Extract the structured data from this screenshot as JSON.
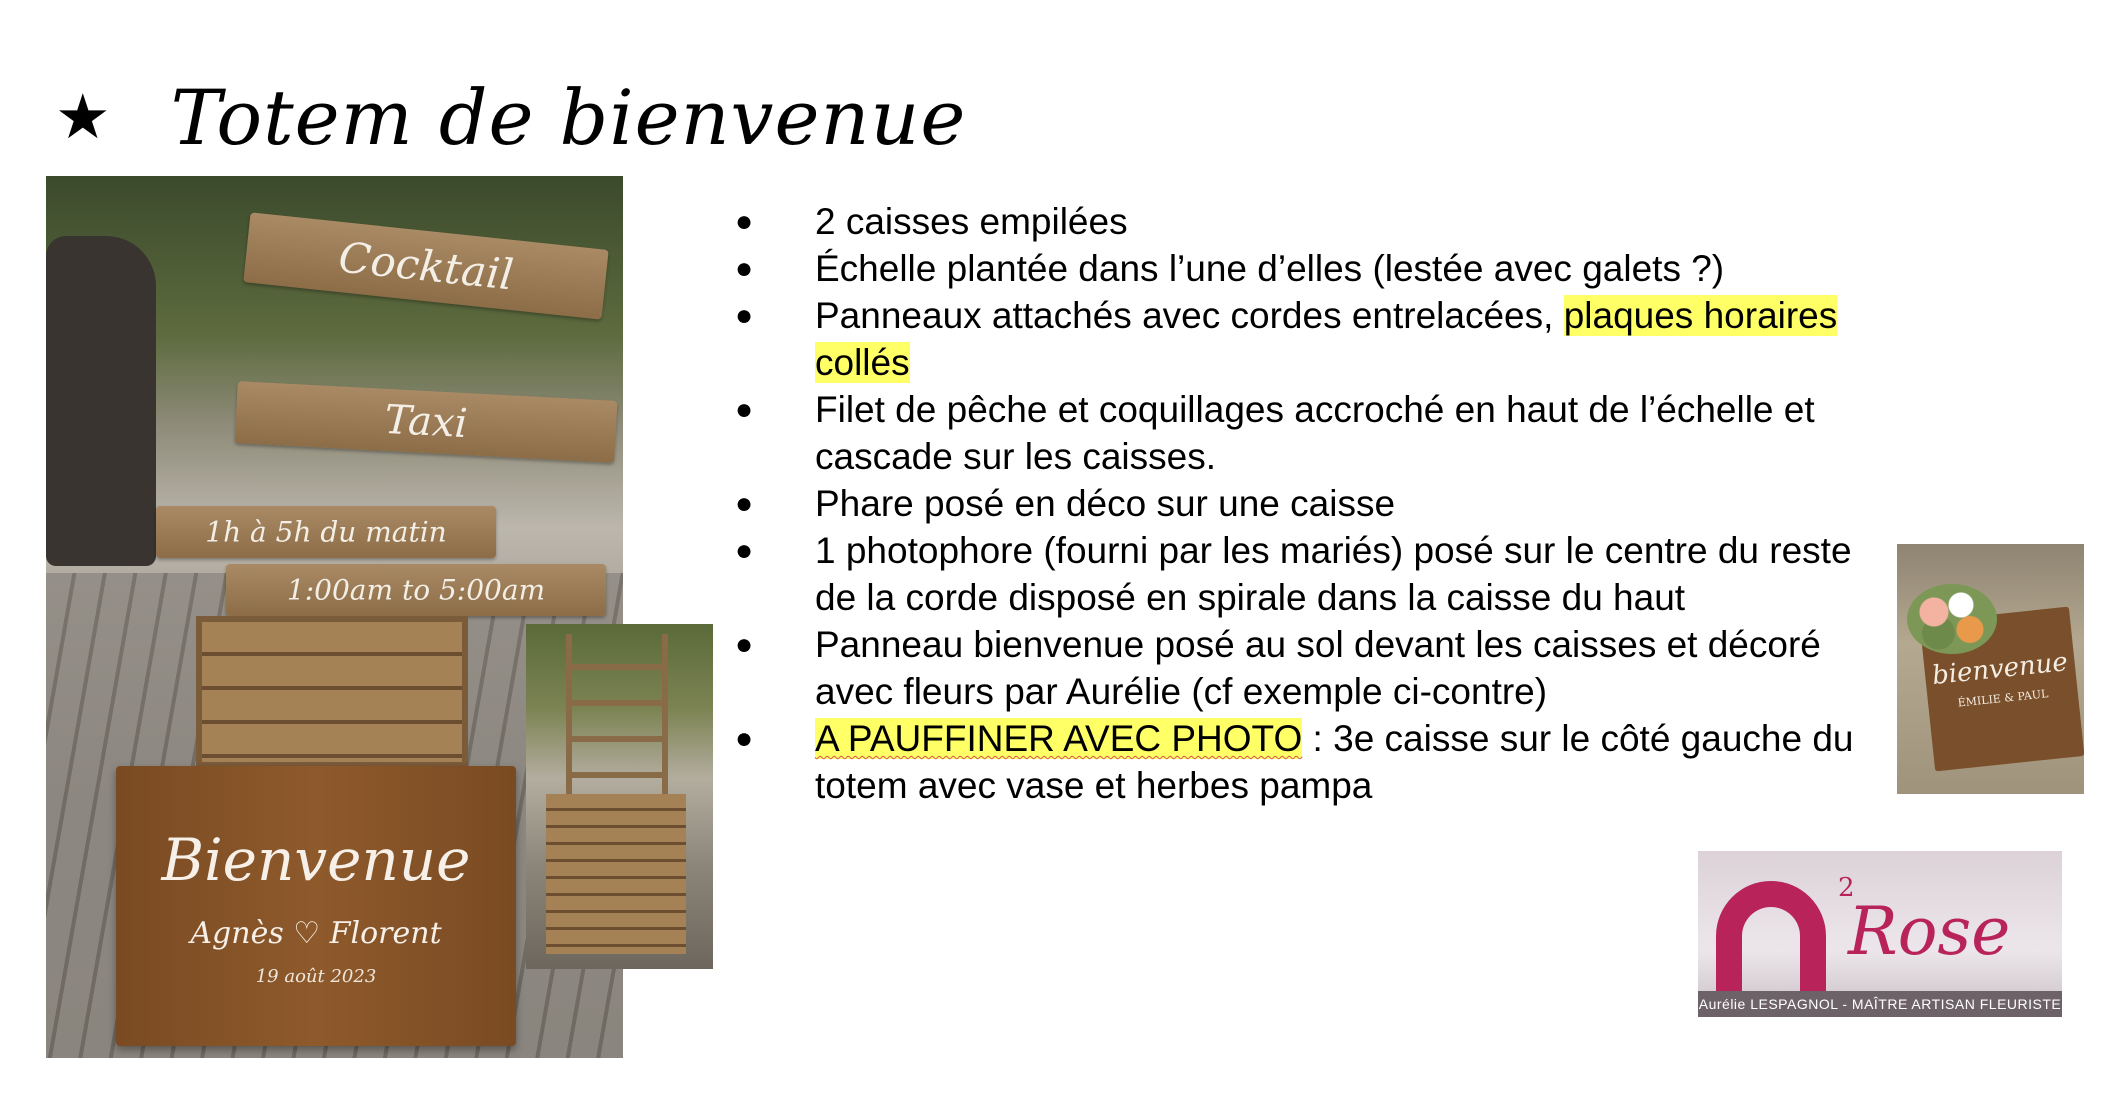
{
  "slide": {
    "title": "Totem de bienvenue",
    "bullets": [
      {
        "text": "2 caisses empilées"
      },
      {
        "text": "Échelle plantée dans l’une d’elles (lestée avec galets ?)"
      },
      {
        "text": "Panneaux attachés avec cordes entrelacées, ",
        "highlight": "plaques horaires collés"
      },
      {
        "text": "Filet de pêche et coquillages accroché en haut de l’échelle et cascade sur les caisses."
      },
      {
        "text": "Phare posé en déco sur une caisse"
      },
      {
        "text": "1 photophore (fourni par les mariés) posé sur le centre du reste de la corde disposé en spirale dans la caisse du haut"
      },
      {
        "text": "Panneau bienvenue posé au sol devant les caisses et décoré avec fleurs par Aurélie (cf exemple ci-contre)"
      },
      {
        "highlight": "A PAUFFINER AVEC PHOTO",
        "text": " : 3e caisse sur le côté gauche du totem avec vase et herbes pampa"
      }
    ]
  },
  "photo_main": {
    "sign_top": "Cocktail",
    "sign_taxi": "Taxi",
    "sign_hours_fr": "1h à 5h du matin",
    "sign_hours_en": "1:00am to 5:00am",
    "board_title": "Bienvenue",
    "board_names": "Agnès ♡ Florent",
    "board_date": "19 août 2023"
  },
  "photo_flowers": {
    "sign_title": "bienvenue",
    "sign_names": "ÉMILIE & PAUL"
  },
  "logo": {
    "number": "2",
    "name": "Rose",
    "caption": "Aurélie LESPAGNOL - MAÎTRE ARTISAN FLEURISTE"
  },
  "colors": {
    "highlight": "#ffff66",
    "logo_brand": "#b8245a"
  }
}
